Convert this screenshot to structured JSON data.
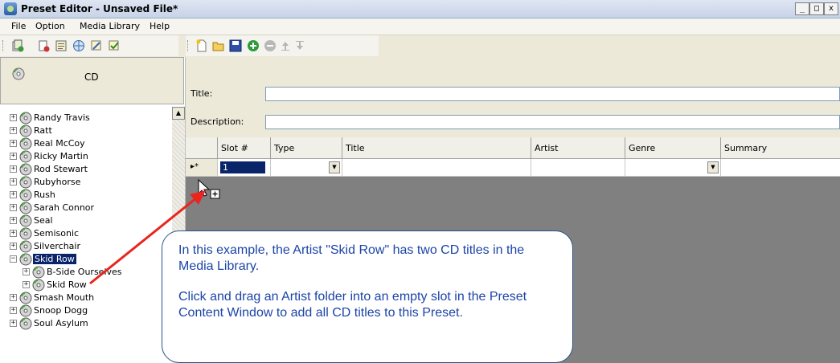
{
  "window": {
    "title": "Preset Editor - Unsaved File*",
    "min": "_",
    "max": "□",
    "close": "x"
  },
  "menu": [
    {
      "label": "File"
    },
    {
      "label": "Option"
    },
    {
      "label": "Media Library"
    },
    {
      "label": "Help"
    }
  ],
  "cd_panel": {
    "label": "CD"
  },
  "tree": {
    "items": [
      {
        "label": "Randy Travis"
      },
      {
        "label": "Ratt"
      },
      {
        "label": "Real McCoy"
      },
      {
        "label": "Ricky Martin"
      },
      {
        "label": "Rod Stewart"
      },
      {
        "label": "Rubyhorse"
      },
      {
        "label": "Rush"
      },
      {
        "label": "Sarah Connor"
      },
      {
        "label": "Seal"
      },
      {
        "label": "Semisonic"
      },
      {
        "label": "Silverchair"
      },
      {
        "label": "Skid Row",
        "expanded": true,
        "selected": true
      },
      {
        "label": "B-Side Ourselves",
        "child": true
      },
      {
        "label": "Skid Row",
        "child": true
      },
      {
        "label": "Smash Mouth"
      },
      {
        "label": "Snoop Dogg"
      },
      {
        "label": "Soul Asylum"
      }
    ]
  },
  "form": {
    "title_label": "Title:",
    "title_value": "",
    "description_label": "Description:",
    "description_value": ""
  },
  "grid": {
    "columns": [
      "",
      "Slot #",
      "Type",
      "Title",
      "Artist",
      "Genre",
      "Summary"
    ],
    "row": {
      "indicator": "▸*",
      "slot": "1",
      "type": "",
      "title": "",
      "artist": "",
      "genre": "",
      "summary": ""
    }
  },
  "callout": {
    "line1": "In this example, the Artist \"Skid Row\" has two CD titles in the Media Library.",
    "line2": "Click and drag an Artist folder into an empty slot in the Preset Content Window to add all CD titles to this Preset."
  },
  "colors": {
    "accent": "#0a246a",
    "callout_text": "#1c44a8",
    "arrow": "#e8261f"
  }
}
